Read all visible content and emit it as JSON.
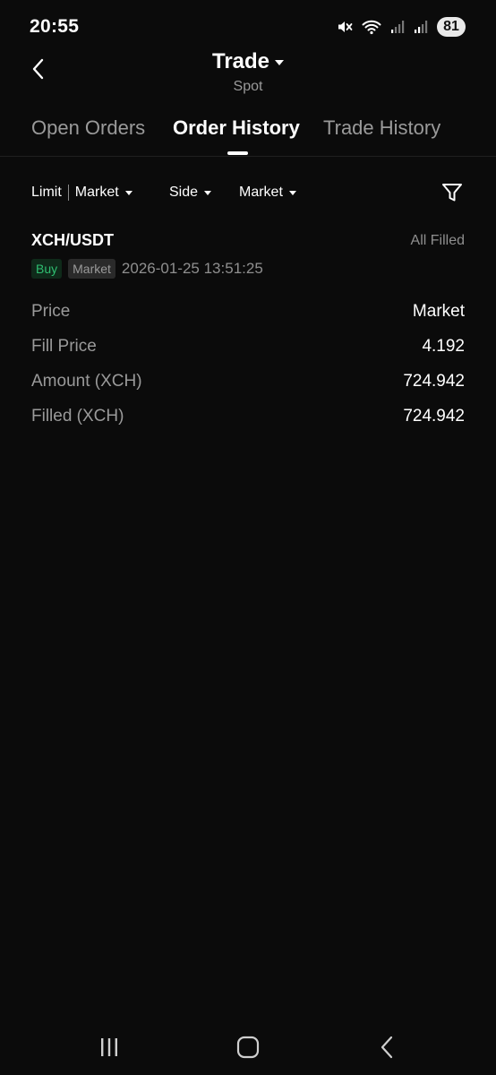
{
  "status_bar": {
    "time": "20:55",
    "battery": "81",
    "icons": [
      "mute-icon",
      "wifi-icon",
      "signal-icon",
      "signal-icon",
      "battery-icon"
    ]
  },
  "header": {
    "title": "Trade",
    "subtitle": "Spot",
    "back_icon": "chevron-left-icon",
    "title_caret_icon": "caret-down-icon"
  },
  "tabs": [
    {
      "label": "Open Orders",
      "active": false
    },
    {
      "label": "Order History",
      "active": true
    },
    {
      "label": "Trade History",
      "active": false
    }
  ],
  "filters": {
    "order_type": {
      "left": "Limit",
      "right": "Market"
    },
    "side": "Side",
    "type": "Market",
    "filter_icon": "funnel-icon"
  },
  "order": {
    "pair": "XCH/USDT",
    "status": "All Filled",
    "side_tag": "Buy",
    "type_tag": "Market",
    "time": "2026-01-25 13:51:25",
    "details": [
      {
        "label": "Price",
        "value": "Market"
      },
      {
        "label": "Fill Price",
        "value": "4.192"
      },
      {
        "label": "Amount (XCH)",
        "value": "724.942"
      },
      {
        "label": "Filled (XCH)",
        "value": "724.942"
      }
    ]
  },
  "nav_bar": {
    "icons": [
      "recent-apps-icon",
      "home-icon",
      "back-icon"
    ]
  },
  "colors": {
    "background": "#0b0b0b",
    "buy_green": "#2fbf71",
    "muted_text": "#9a9a9a"
  }
}
